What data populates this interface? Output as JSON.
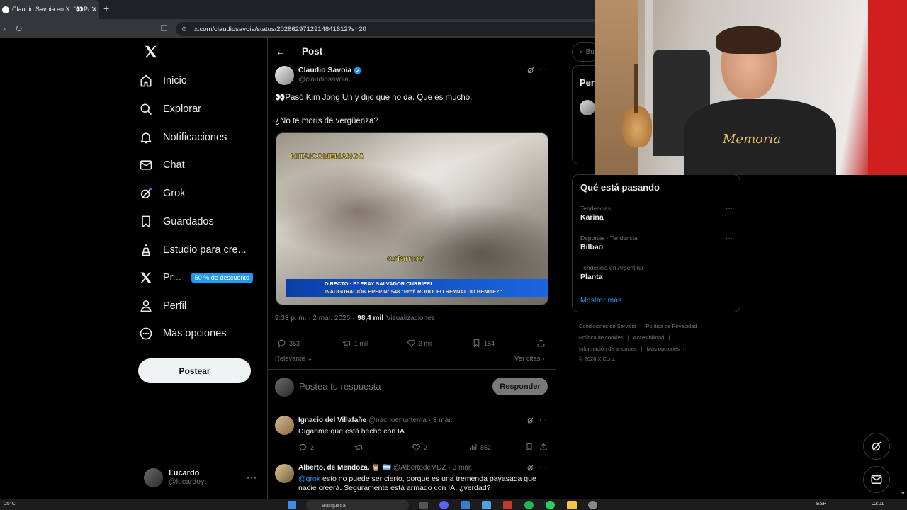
{
  "browser": {
    "tab_title": "Claudio Savoia en X: \"👀Pasó",
    "url": "x.com/claudiosavoia/status/2028629712914841612?s=20"
  },
  "nav": {
    "items": [
      {
        "label": "Inicio",
        "icon": "home-icon"
      },
      {
        "label": "Explorar",
        "icon": "search-icon"
      },
      {
        "label": "Notificaciones",
        "icon": "bell-icon"
      },
      {
        "label": "Chat",
        "icon": "mail-icon"
      },
      {
        "label": "Grok",
        "icon": "grok-icon"
      },
      {
        "label": "Guardados",
        "icon": "bookmark-icon"
      },
      {
        "label": "Estudio para cre...",
        "icon": "flask-icon"
      },
      {
        "label": "Pr...",
        "icon": "x-logo-icon"
      },
      {
        "label": "Perfil",
        "icon": "person-icon"
      },
      {
        "label": "Más opciones",
        "icon": "more-circle-icon"
      }
    ],
    "premium_badge": "50 % de descuento",
    "post_button": "Postear",
    "account": {
      "name": "Lucardo",
      "handle": "@lucardoyt"
    }
  },
  "post": {
    "header": "Post",
    "author": "Claudio Savoia",
    "handle": "@claudiosavoia",
    "text1": "👀Pasó Kim Jong Un y dijo que no da. Que es mucho.",
    "text2": "¿No te morís de vergüenza?",
    "media": {
      "overlay_top": "MITAICOMEMANGO",
      "caption": "estamos",
      "banner_line1": "DIRECTO · Bº FRAY SALVADOR CURRIERI",
      "banner_line2": "INAUGURACIÓN EPEP N° 548 \"Prof. RODOLFO REYNALDO BENITEZ\""
    },
    "time": "9:33 p. m. · 2 mar. 2026 ·",
    "views_value": "98,4 mil",
    "views_label": "Visualizaciones",
    "replies": "353",
    "reposts": "1 mil",
    "likes": "3 mil",
    "bookmarks": "154",
    "sort_label": "Relevante",
    "quotes_label": "Ver citas",
    "reply_placeholder": "Postea tu respuesta",
    "reply_button": "Responder"
  },
  "replies": [
    {
      "name": "Ignacio del Villafañe",
      "handle": "@nachoenuntema",
      "date": "· 3 mar.",
      "text": "Díganme que está hecho con IA",
      "replies": "2",
      "likes": "2",
      "views": "852"
    },
    {
      "name": "Alberto, de Mendoza. 🦉 🇦🇷",
      "handle": "@AlbertodeMDZ",
      "date": "· 3 mar.",
      "mention": "@grok",
      "text": " esto no puede ser cierto, porque es una tremenda payasada que nadie creerá. Seguramente está armado con IA, ¿verdad?"
    }
  ],
  "sidebar": {
    "search_placeholder": "Bu",
    "per_title": "Per",
    "trends_title": "Qué está pasando",
    "trends": [
      {
        "context": "Tendencias",
        "name": "Karina"
      },
      {
        "context": "Deportes · Tendencia",
        "name": "Bilbao"
      },
      {
        "context": "Tendencia en Argentina",
        "name": "Planta"
      }
    ],
    "show_more": "Mostrar más",
    "footer": {
      "l1a": "Condiciones de Servicio",
      "l1b": "Política de Privacidad",
      "l2a": "Política de cookies",
      "l2b": "Accesibilidad",
      "l3a": "Información de anuncios",
      "l3b": "Más opciones ···",
      "copy": "© 2026 X Corp."
    }
  },
  "webcam": {
    "shirt_text": "Memoria"
  },
  "taskbar": {
    "weather": "25°C",
    "search": "Búsqueda",
    "lang": "ESP",
    "time": "02:01"
  },
  "colors": {
    "accent": "#1d9bf0",
    "background": "#000000",
    "border": "#2f3336",
    "muted": "#71767b"
  }
}
